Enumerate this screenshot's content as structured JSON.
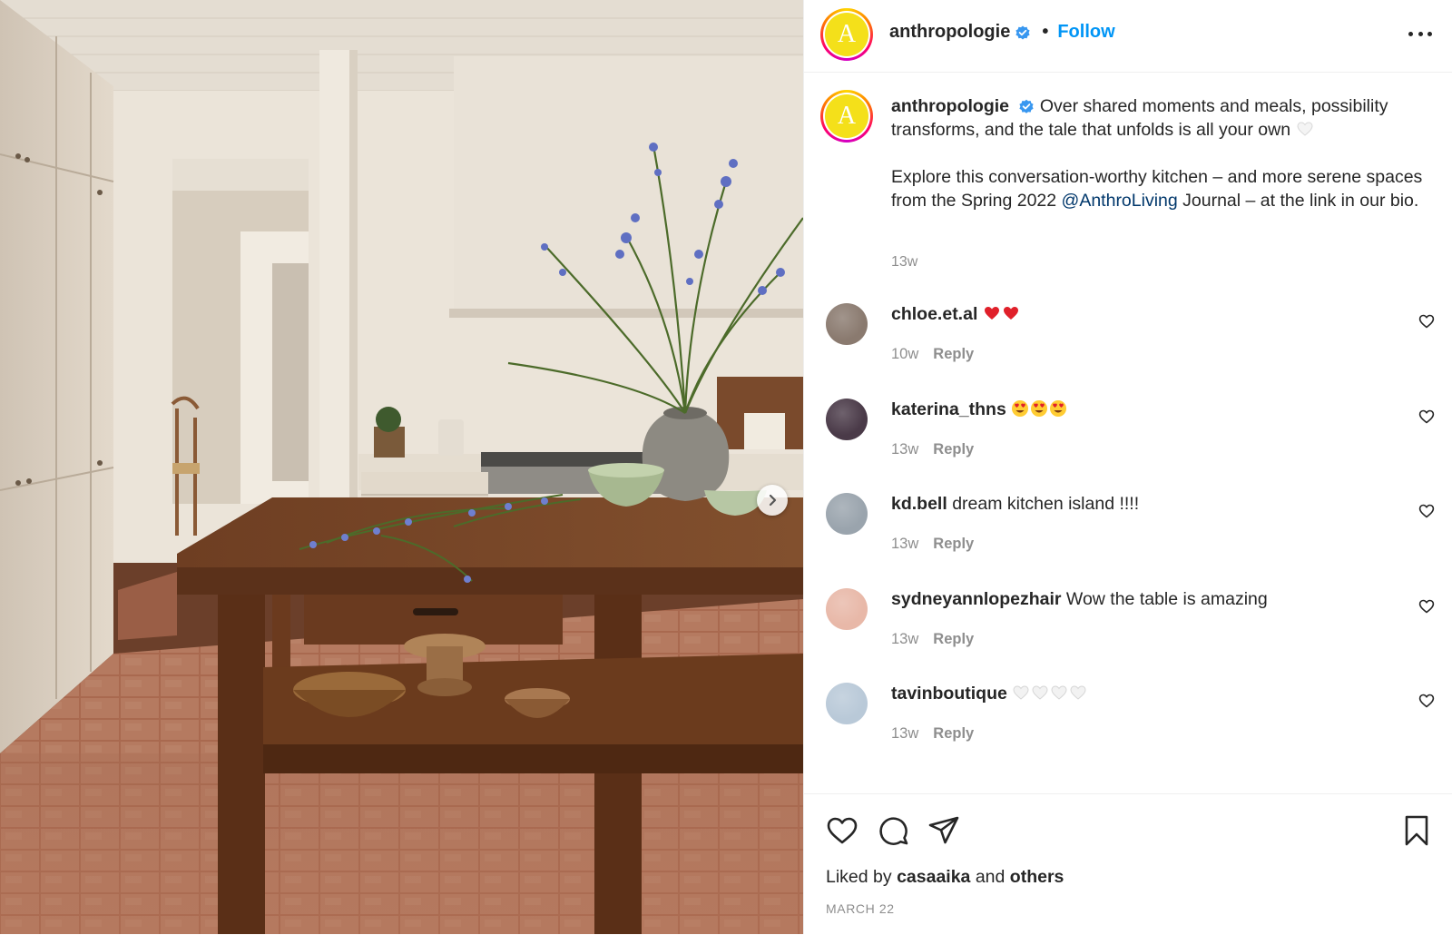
{
  "post": {
    "image_alt": "Kitchen with rustic wooden island, flowers in a stone vase and terracotta floor",
    "next_label": "Next"
  },
  "header": {
    "avatar_letter": "A",
    "username": "anthropologie",
    "separator": "•",
    "follow_label": "Follow"
  },
  "caption": {
    "username": "anthropologie",
    "text_1": "Over shared moments and meals, possibility transforms, and the tale that unfolds is all your own",
    "text_2a": "Explore this conversation-worthy kitchen – and more serene spaces from the Spring 2022",
    "mention": "@AnthroLiving",
    "text_2b": "Journal – at the link in our bio.",
    "time": "13w"
  },
  "comments": [
    {
      "username": "chloe.et.al",
      "text": "",
      "emoji": [
        "heart-red",
        "heart-red"
      ],
      "time": "10w",
      "reply": "Reply",
      "avatar_color": "#8a7a6f"
    },
    {
      "username": "katerina_thns",
      "text": "",
      "emoji": [
        "heart-eyes",
        "heart-eyes",
        "heart-eyes"
      ],
      "time": "13w",
      "reply": "Reply",
      "avatar_color": "#4a3a48"
    },
    {
      "username": "kd.bell",
      "text": "dream kitchen island !!!!",
      "emoji": [],
      "time": "13w",
      "reply": "Reply",
      "avatar_color": "#9aa4ad"
    },
    {
      "username": "sydneyannlopezhair",
      "text": "Wow the table is amazing",
      "emoji": [],
      "time": "13w",
      "reply": "Reply",
      "avatar_color": "#e8b8a8"
    },
    {
      "username": "tavinboutique",
      "text": "",
      "emoji": [
        "heart-white",
        "heart-white",
        "heart-white",
        "heart-white"
      ],
      "time": "13w",
      "reply": "Reply",
      "avatar_color": "#b9c9d8"
    }
  ],
  "footer": {
    "liked_prefix": "Liked by",
    "liked_user": "casaaika",
    "liked_and": "and",
    "liked_others": "others",
    "date": "MARCH 22"
  },
  "icons": {
    "verified": "verified-badge-icon",
    "more": "more-options-icon",
    "like": "heart-outline-icon",
    "comment": "comment-bubble-icon",
    "share": "paper-plane-icon",
    "save": "bookmark-icon",
    "next": "chevron-right-icon"
  },
  "colors": {
    "follow": "#0095f6",
    "mention": "#00376b",
    "verified": "#3897f0",
    "meta": "#8e8e8e"
  }
}
